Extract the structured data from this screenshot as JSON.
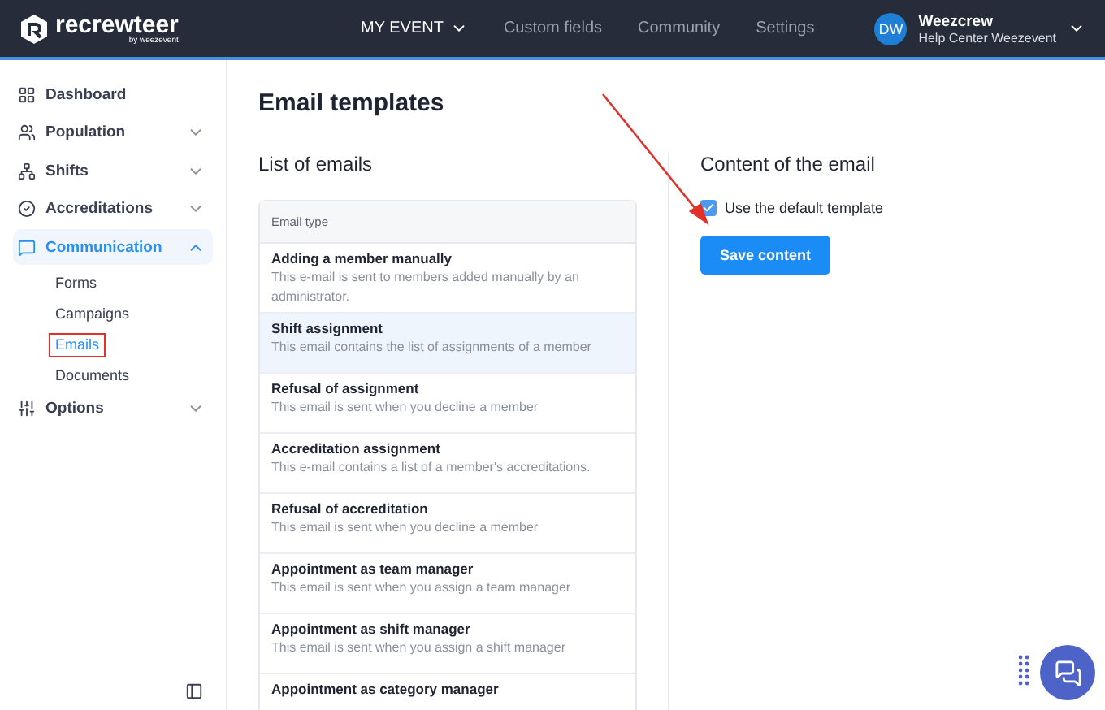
{
  "navbar": {
    "logo": "recrewteer",
    "logo_sub": "by weezevent",
    "menu": [
      {
        "label": "MY EVENT",
        "selected": true,
        "dropdown": true
      },
      {
        "label": "Custom fields",
        "selected": false,
        "dropdown": false
      },
      {
        "label": "Community",
        "selected": false,
        "dropdown": false
      },
      {
        "label": "Settings",
        "selected": false,
        "dropdown": false
      }
    ],
    "user": {
      "initials": "DW",
      "name": "Weezcrew",
      "organization": "Help Center Weezevent"
    }
  },
  "sidebar": {
    "items": [
      {
        "label": "Dashboard",
        "selected": false
      },
      {
        "label": "Population",
        "selected": false,
        "expanded": false
      },
      {
        "label": "Shifts",
        "selected": false,
        "expanded": false
      },
      {
        "label": "Accreditations",
        "selected": false,
        "expanded": false
      },
      {
        "label": "Communication",
        "selected": true,
        "expanded": true,
        "children": [
          {
            "label": "Forms",
            "selected": false,
            "highlighted": false
          },
          {
            "label": "Campaigns",
            "selected": false,
            "highlighted": false
          },
          {
            "label": "Emails",
            "selected": true,
            "highlighted": true
          },
          {
            "label": "Documents",
            "selected": false,
            "highlighted": false
          }
        ]
      },
      {
        "label": "Options",
        "selected": false,
        "expanded": false
      }
    ]
  },
  "page": {
    "title": "Email templates"
  },
  "list": {
    "title": "List of emails",
    "column": "Email type",
    "rows": [
      {
        "name": "Adding a member manually",
        "description": "This e-mail is sent to members added manually by an administrator.",
        "selected": false
      },
      {
        "name": "Shift assignment",
        "description": "This email contains the list of assignments of a member",
        "selected": true
      },
      {
        "name": "Refusal of assignment",
        "description": "This email is sent when you decline a member",
        "selected": false
      },
      {
        "name": "Accreditation assignment",
        "description": "This e-mail contains a list of a member's accreditations.",
        "selected": false
      },
      {
        "name": "Refusal of accreditation",
        "description": "This email is sent when you decline a member",
        "selected": false
      },
      {
        "name": "Appointment as team manager",
        "description": "This email is sent when you assign a team manager",
        "selected": false
      },
      {
        "name": "Appointment as shift manager",
        "description": "This email is sent when you assign a shift manager",
        "selected": false
      },
      {
        "name": "Appointment as category manager",
        "selected": false
      }
    ]
  },
  "content": {
    "title": "Content of the email",
    "use_default": {
      "label": "Use the default template",
      "checked": true
    },
    "save_button": "Save content"
  }
}
